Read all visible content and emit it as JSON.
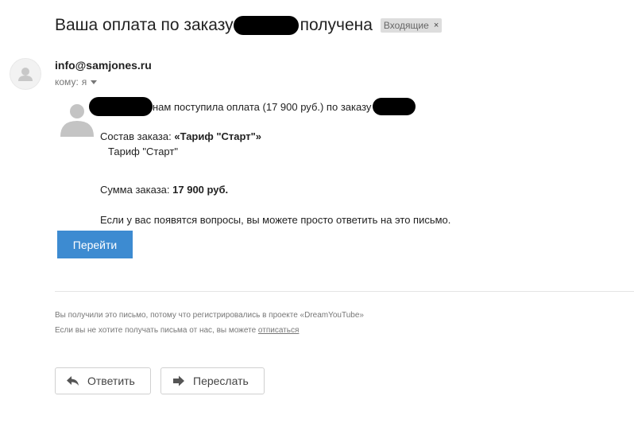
{
  "email": {
    "subject_before": "Ваша оплата по заказу",
    "subject_after": "получена",
    "label": "Входящие",
    "label_remove": "×",
    "sender": "info@samjones.ru",
    "to_prefix": "кому:",
    "to_value": "я"
  },
  "body": {
    "line1": "нам поступила оплата (17 900 руб.) по заказу",
    "order_label": "Состав заказа:",
    "order_value": "«Тариф \"Старт\"»",
    "order_item": "Тариф \"Старт\"",
    "sum_label": "Сумма заказа:",
    "sum_value": "17 900 руб.",
    "questions": "Если у вас появятся вопросы, вы можете просто ответить на это письмо.",
    "go_button": "Перейти"
  },
  "footer": {
    "line1": "Вы получили это письмо, потому что регистрировались в проекте «DreamYouTube»",
    "line2_prefix": "Если вы не хотите получать письма от нас, вы можете",
    "unsubscribe": "отписаться"
  },
  "actions": {
    "reply": "Ответить",
    "forward": "Переслать"
  }
}
